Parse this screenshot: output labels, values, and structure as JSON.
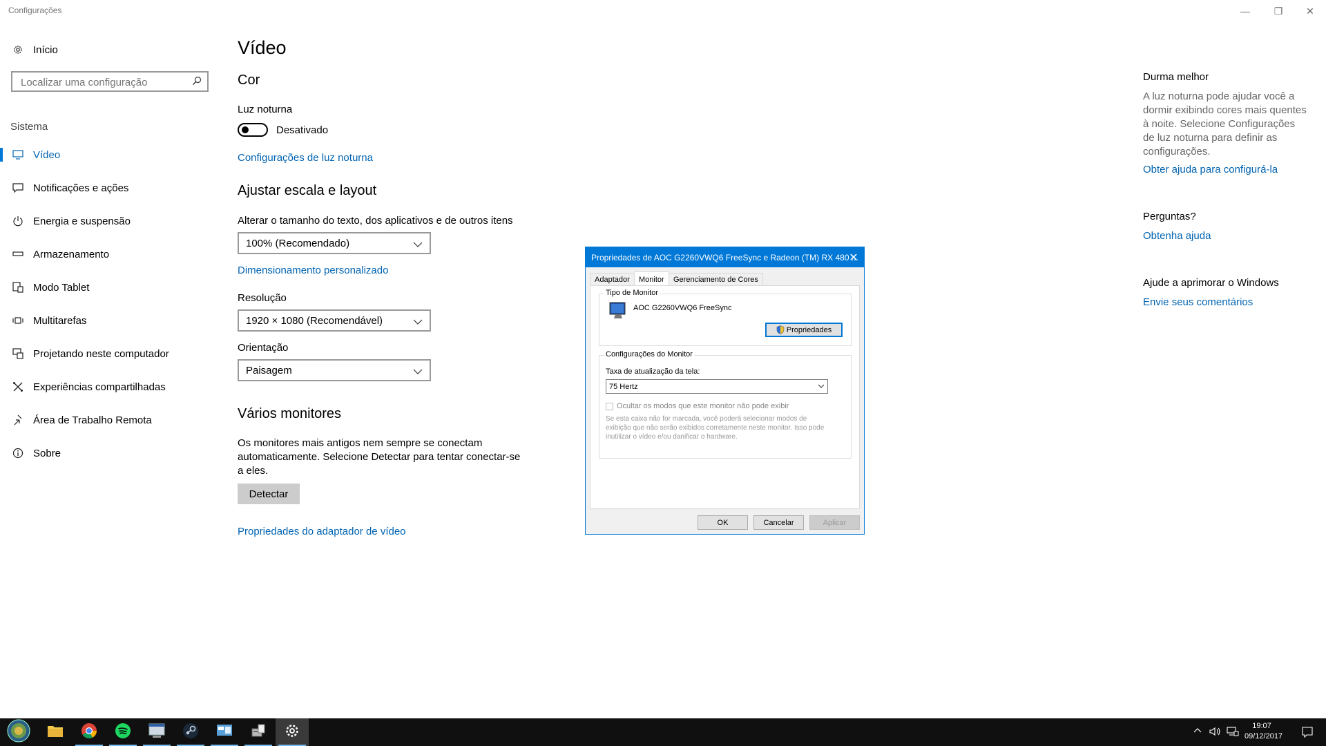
{
  "window": {
    "title": "Configurações",
    "minimize": "—",
    "restore": "❐",
    "close": "✕"
  },
  "sidebar": {
    "home": "Início",
    "search_placeholder": "Localizar uma configuração",
    "section": "Sistema",
    "items": [
      {
        "label": "Vídeo",
        "icon": "display-icon"
      },
      {
        "label": "Notificações e ações",
        "icon": "notification-icon"
      },
      {
        "label": "Energia e suspensão",
        "icon": "power-icon"
      },
      {
        "label": "Armazenamento",
        "icon": "storage-icon"
      },
      {
        "label": "Modo Tablet",
        "icon": "tablet-icon"
      },
      {
        "label": "Multitarefas",
        "icon": "multitask-icon"
      },
      {
        "label": "Projetando neste computador",
        "icon": "project-icon"
      },
      {
        "label": "Experiências compartilhadas",
        "icon": "shared-icon"
      },
      {
        "label": "Área de Trabalho Remota",
        "icon": "remote-icon"
      },
      {
        "label": "Sobre",
        "icon": "info-icon"
      }
    ]
  },
  "main": {
    "title": "Vídeo",
    "color_heading": "Cor",
    "night_light_label": "Luz noturna",
    "night_light_state": "Desativado",
    "night_light_link": "Configurações de luz noturna",
    "scale_heading": "Ajustar escala e layout",
    "scale_label": "Alterar o tamanho do texto, dos aplicativos e de outros itens",
    "scale_value": "100% (Recomendado)",
    "custom_scale_link": "Dimensionamento personalizado",
    "resolution_label": "Resolução",
    "resolution_value": "1920 × 1080 (Recomendável)",
    "orientation_label": "Orientação",
    "orientation_value": "Paisagem",
    "monitors_heading": "Vários monitores",
    "monitors_text": "Os monitores mais antigos nem sempre se conectam automaticamente. Selecione Detectar para tentar conectar-se a eles.",
    "detect_button": "Detectar",
    "adapter_link": "Propriedades do adaptador de vídeo"
  },
  "right": {
    "sleep_heading": "Durma melhor",
    "sleep_text": "A luz noturna pode ajudar você a dormir exibindo cores mais quentes à noite. Selecione Configurações de luz noturna para definir as configurações.",
    "sleep_link": "Obter ajuda para configurá-la",
    "questions_heading": "Perguntas?",
    "questions_link": "Obtenha ajuda",
    "improve_heading": "Ajude a aprimorar o Windows",
    "improve_link": "Envie seus comentários"
  },
  "dialog": {
    "title": "Propriedades de AOC G2260VWQ6 FreeSync e Radeon (TM) RX 480 ...",
    "tabs": [
      "Adaptador",
      "Monitor",
      "Gerenciamento de Cores"
    ],
    "monitor_type_label": "Tipo de Monitor",
    "monitor_name": "AOC G2260VWQ6 FreeSync",
    "properties_button": "Propriedades",
    "settings_label": "Configurações do Monitor",
    "refresh_label": "Taxa de atualização da tela:",
    "refresh_value": "75 Hertz",
    "hide_modes_label": "Ocultar os modos que este monitor não pode exibir",
    "hide_modes_note": "Se esta caixa não for marcada, você poderá selecionar modos de exibição que não serão exibidos corretamente neste monitor. Isso pode inutilizar o vídeo e/ou danificar o hardware.",
    "ok": "OK",
    "cancel": "Cancelar",
    "apply": "Aplicar"
  },
  "taskbar": {
    "time": "19:07",
    "date": "09/12/2017"
  },
  "colors": {
    "accent": "#0078d7",
    "link": "#0063b1",
    "taskbar": "#101010"
  }
}
